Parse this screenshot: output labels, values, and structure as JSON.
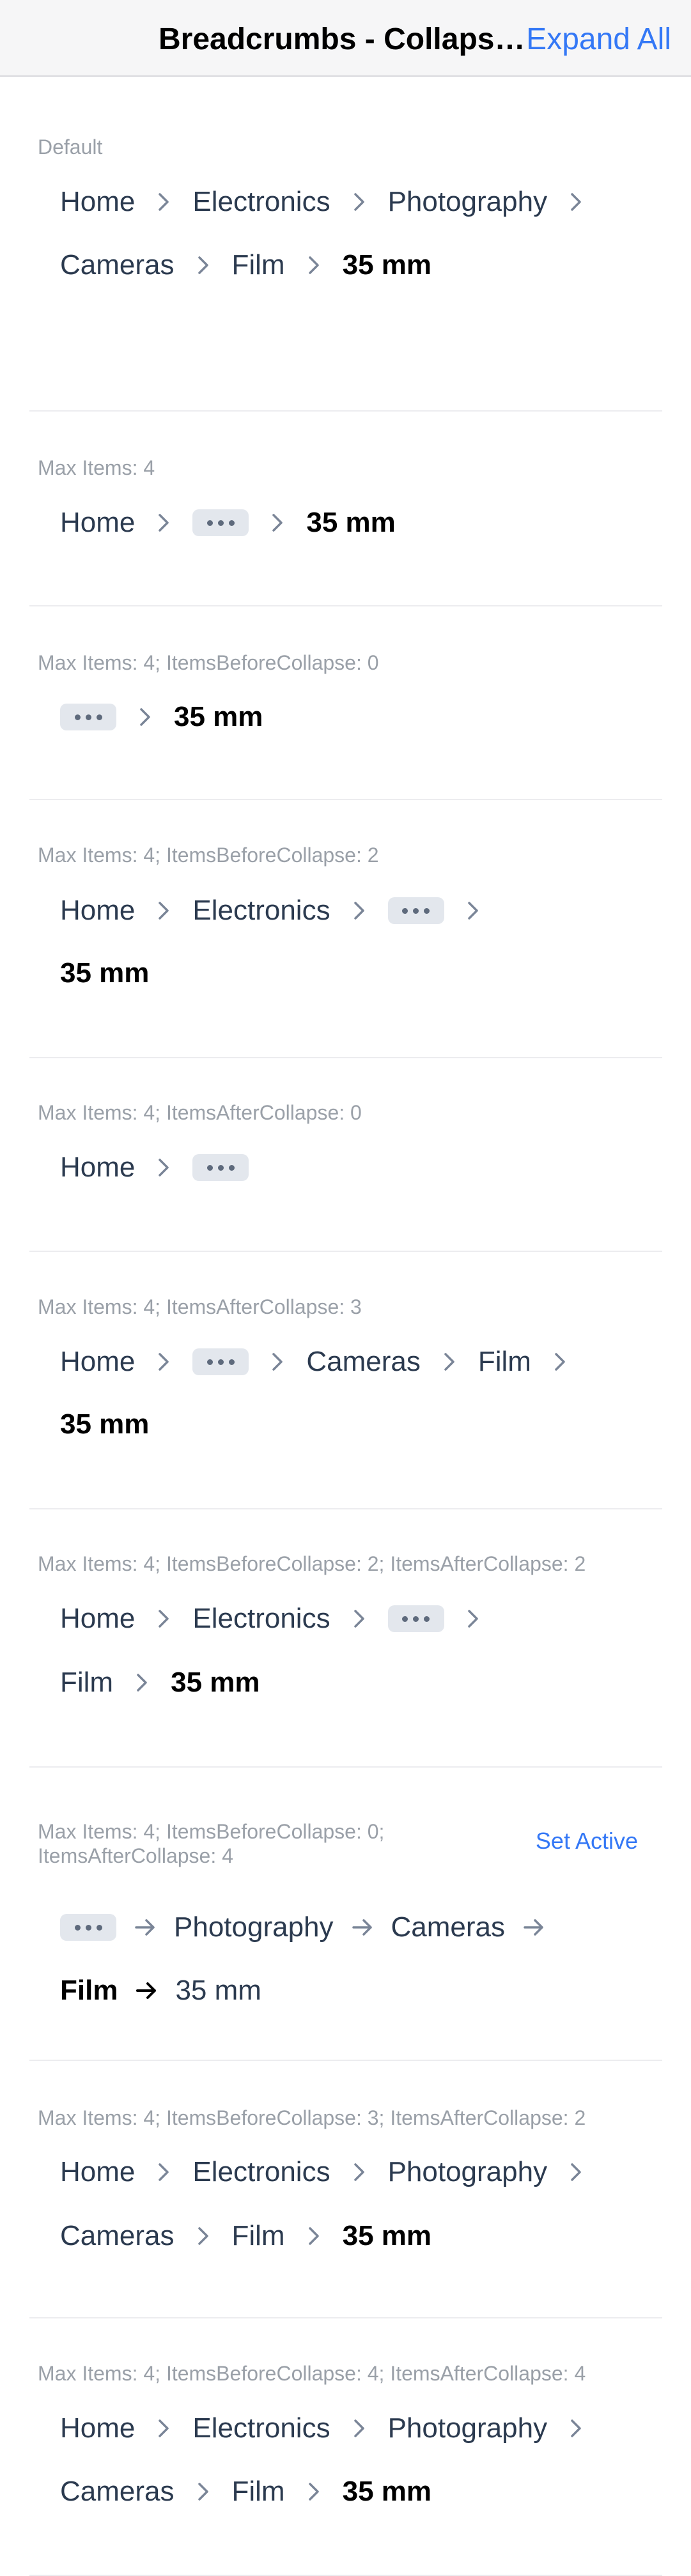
{
  "nav": {
    "title": "Breadcrumbs - Collapsing",
    "action": "Expand All"
  },
  "crumbs": {
    "home": "Home",
    "electronics": "Electronics",
    "photography": "Photography",
    "cameras": "Cameras",
    "film": "Film",
    "mm35": "35 mm"
  },
  "sections": [
    {
      "caption": "Default"
    },
    {
      "caption": "Max Items: 4"
    },
    {
      "caption": "Max Items: 4; ItemsBeforeCollapse: 0"
    },
    {
      "caption": "Max Items: 4; ItemsBeforeCollapse: 2"
    },
    {
      "caption": "Max Items: 4; ItemsAfterCollapse: 0"
    },
    {
      "caption": "Max Items: 4; ItemsAfterCollapse: 3"
    },
    {
      "caption": "Max Items: 4; ItemsBeforeCollapse: 2; ItemsAfterCollapse: 2"
    },
    {
      "caption_line1": "Max Items: 4; ItemsBeforeCollapse: 0;",
      "caption_line2": "ItemsAfterCollapse: 4",
      "action": "Set Active"
    },
    {
      "caption": "Max Items: 4; ItemsBeforeCollapse: 3; ItemsAfterCollapse: 2"
    },
    {
      "caption": "Max Items: 4; ItemsBeforeCollapse: 4; ItemsAfterCollapse: 4"
    }
  ],
  "icons": {
    "separator": "chevron-right-icon",
    "arrow_separator": "arrow-right-icon",
    "collapse": "ellipsis-icon"
  },
  "colors": {
    "accent": "#3478f6",
    "crumb": "#2b3a4f",
    "caption": "#9aa0a8",
    "ellipsis_bg": "#e3e7ed"
  }
}
